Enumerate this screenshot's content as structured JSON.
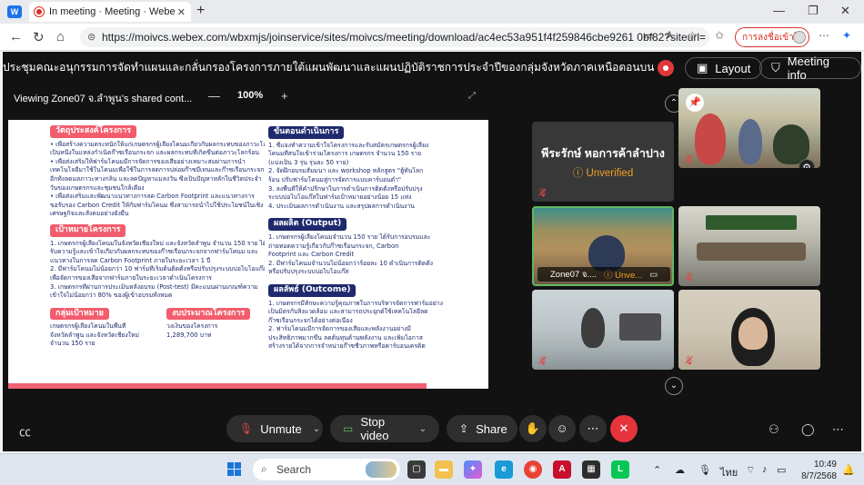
{
  "browser": {
    "tab_title": "In meeting · Meeting · Webe",
    "tab_close": "✕",
    "new_tab": "+",
    "url": "https://moivcs.webex.com/wbxmjs/joinservice/sites/moivcs/meeting/download/ac4ec53a951f4f259846cbe9261 0bf82?siteurl=",
    "translate_label": "การลงชื่อเข้าใช้",
    "window_controls": [
      "—",
      "❐",
      "✕"
    ]
  },
  "meeting": {
    "title": "ประชุมคณะอนุกรรมการจัดทำแผนและกลั่นกรองโครงการภายใต้แผนพัฒนาและแผนปฏิบัติราชการประจำปีของกลุ่มจังหวัดภาคเหนือตอนบน 1",
    "layout_label": "Layout",
    "meeting_info_label": "Meeting info",
    "viewing_label": "Viewing Zone07 จ.ลำพูน's shared cont...",
    "zoom_percent": "100%",
    "zoom_minus": "—",
    "zoom_plus": "+"
  },
  "document": {
    "left_col": {
      "objective_title": "วัตถุประสงค์โครงการ",
      "objective_lines": [
        "• เพื่อสร้างความตระหนักให้แก่เกษตรกรผู้เลี้ยงโคนมเกี่ยวกับผลกระทบของภาวะโลกร้อน",
        "  เป็นหนึ่งในแหล่งกำเนิดก๊าซเรือนกระจก และผลกระทบที่เกิดขึ้นต่อภาวะโลกร้อน",
        "• เพื่อส่งเสริมให้ฟาร์มโคนมมีการจัดการของเสียอย่างเหมาะสมผ่านการนำ",
        "  เทคโนโลยีมาใช้ในโคนมเพื่อใช้ในการลดการปล่อยก๊าซมีเทนและก๊าซเรือนกระจกอื่น ๆ",
        "  อีกทั้งลดมลภาวะทางกลิ่น และลดปัญหาแมลงวัน ซึ่งเป็นปัญหาหลักในชีวิตประจำ",
        "  วันของเกษตรกรและชุมชนใกล้เคียง",
        "• เพื่อส่งเสริมและพัฒนาแนวทางการลด Carbon Footprint และแนวทางการ",
        "  ขอรับรอง Carbon Credit ให้กับฟาร์มโคนม ซึ่งสามารถนำไปใช้ประโยชน์ในเชิง",
        "  เศรษฐกิจและสังคมอย่างยั่งยืน"
      ],
      "target_title": "เป้าหมายโครงการ",
      "target_lines": [
        "1. เกษตรกรผู้เลี้ยงโคนมในจังหวัดเชียงใหม่ และจังหวัดลำพูน จำนวน 150 ราย ได้",
        "   รับความรู้และเข้าใจเกี่ยวกับผลกระทบของก๊าซเรือนกระจกจากฟาร์มโคนม และ",
        "   แนวทางในการลด Carbon Footprint ภายในระยะเวลา 1 ปี",
        "2. มีฟาร์มโคนมไม่น้อยกว่า 10 ฟาร์มที่เริ่มต้นติดตั้งหรือปรับปรุงระบบบ่อไบโอแก๊ส",
        "   เพื่อจัดการของเสียจากฟาร์มภายในระยะเวลาดำเนินโครงการ",
        "3. เกษตรกรที่ผ่านการประเมินหลังอบรม (Post-test) มีคะแนนผ่านเกณฑ์ความ",
        "   เข้าใจไม่น้อยกว่า 80% ของผู้เข้าอบรมทั้งหมด"
      ],
      "group_title": "กลุ่มเป้าหมาย",
      "group_lines": [
        "เกษตรกรผู้เลี้ยงโคนมในพื้นที่",
        "จังหวัดลำพูน และจังหวัดเชียงใหม่",
        "จำนวน 150 ราย"
      ],
      "budget_title": "งบประมาณโครงการ",
      "budget_lines": [
        "วงเงินของโครงการ",
        "1,289,700 บาท"
      ]
    },
    "right_col": {
      "steps_title": "ขั้นตอนดำเนินการ",
      "steps_lines": [
        "1. ชี้แจงทำความเข้าใจโครงการและรับสมัครเกษตรกรผู้เลี้ยง",
        "   โคนมที่สนใจเข้าร่วมโครงการ เกษตรกร จำนวน 150 ราย",
        "   (แบ่งเป็น 3 รุ่น รุ่นละ 50 ราย)",
        "2. จัดฝึกอบรมสัมมนา และ workshop หลักสูตร \"ฮู้ทันโลก",
        "   ร้อน ปรับฟาร์มโคนมสู่การจัดการแบบคาร์บอนต่ำ\"",
        "3. ลงพื้นที่ให้คำปรึกษาในการดำเนินการติดตั้งหรือปรับปรุง",
        "   ระบบบ่อไบโอแก๊สในฟาร์มเป้าหมายอย่างน้อย 15 แห่ง",
        "4. ประเมินผลการดำเนินงาน และสรุปผลการดำเนินงาน"
      ],
      "output_title": "ผลผลิต (Output)",
      "output_lines": [
        "1. เกษตรกรผู้เลี้ยงโคนมจำนวน 150 ราย ได้รับการอบรมและ",
        "   ถ่ายทอดความรู้เกี่ยวกับก๊าซเรือนกระจก, Carbon",
        "   Footprint และ Carbon Credit",
        "2. มีฟาร์มโคนมจำนวนไม่น้อยกว่าร้อยละ 10 ดำเนินการติดตั้ง",
        "   หรือปรับปรุงระบบบ่อไบโอแก๊ส"
      ],
      "outcome_title": "ผลลัพธ์ (Outcome)",
      "outcome_lines": [
        "1. เกษตรกรมีทักษะความรู้คุณภาพในการบริหารจัดการฟาร์มอย่าง",
        "   เป็นมิตรกับสิ่งแวดล้อม และสามารถประยุกต์ใช้เทคโนโลยีลด",
        "   ก๊าซเรือนกระจกได้อย่างต่อเนื่อง",
        "2. ฟาร์มโคนมมีการจัดการของเสียและพลังงานอย่างมี",
        "   ประสิทธิภาพมากขึ้น ลดต้นทุนด้านพลังงาน และเพิ่มโอกาส",
        "   สร้างรายได้จากการจำหน่ายก๊าซชีวภาพหรือคาร์บอนเครดิต"
      ]
    }
  },
  "participants": {
    "name_tile_name": "พีระรักษ์ หอการค้าลำปาง",
    "name_tile_status": "Unverified",
    "zone_name": "Zone07 จ....",
    "zone_status": "Unve..."
  },
  "controls": {
    "unmute": "Unmute",
    "stop_video": "Stop video",
    "share": "Share"
  },
  "taskbar": {
    "search": "Search",
    "lang": "ไทย",
    "time": "10:49",
    "date": "8/7/2568"
  },
  "colors": {
    "doc_pink": "#f25c6c",
    "doc_navy": "#1f2a6e",
    "unverified": "#f0a32a",
    "leave_red": "#e5343a"
  }
}
